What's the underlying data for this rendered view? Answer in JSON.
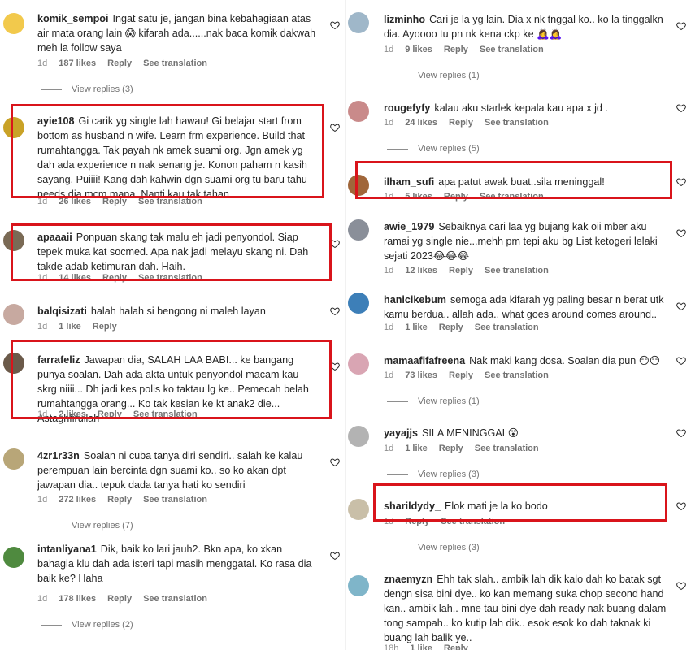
{
  "left": [
    {
      "username": "komik_sempoi",
      "text": "Ingat satu je, jangan bina kebahagiaan atas air mata orang lain 😱 kifarah ada......nak baca komik dakwah meh la follow saya",
      "time": "1d",
      "likes": "187 likes",
      "reply": "Reply",
      "translate": "See translation",
      "view_replies": "View replies (3)",
      "avatar_color": "#f2c94c"
    },
    {
      "username": "ayie108",
      "text": "Gi carik yg single lah hawau! Gi belajar start from bottom as husband n wife. Learn frm experience. Build that rumahtangga. Tak payah nk amek suami org. Jgn amek yg dah ada experience n nak senang je. Konon paham n kasih sayang. Puiiii! Kang dah kahwin dgn suami org tu baru tahu needs dia mcm mana. Nanti kau tak tahan.",
      "time": "1d",
      "likes": "26 likes",
      "reply": "Reply",
      "translate": "See translation",
      "avatar_color": "#c9a227"
    },
    {
      "username": "apaaaii",
      "text": "Ponpuan skang tak malu eh jadi penyondol. Siap tepek muka kat socmed. Apa nak jadi melayu skang ni. Dah takde adab ketimuran dah. Haih.",
      "time": "1d",
      "likes": "14 likes",
      "reply": "Reply",
      "translate": "See translation",
      "avatar_color": "#7a6a55"
    },
    {
      "username": "balqisizati",
      "text": "halah halah si bengong ni maleh layan",
      "time": "1d",
      "likes": "1 like",
      "reply": "Reply",
      "avatar_color": "#c7a9a0"
    },
    {
      "username": "farrafeliz",
      "text": "Jawapan dia, SALAH LAA BABI... ke bangang punya soalan. Dah ada akta untuk penyondol macam kau skrg niiii... Dh jadi kes polis ko taktau lg ke.. Pemecah belah rumahtangga orang... Ko tak kesian ke kt anak2 die... Astaghfirullah",
      "time": "1d",
      "likes": "2 likes",
      "reply": "Reply",
      "translate": "See translation",
      "avatar_color": "#6b5a4a"
    },
    {
      "username": "4zr1r33n",
      "text": "Soalan ni cuba tanya diri sendiri.. salah ke kalau perempuan lain bercinta dgn suami ko.. so ko akan dpt jawapan dia.. tepuk dada tanya hati ko sendiri",
      "time": "1d",
      "likes": "272 likes",
      "reply": "Reply",
      "translate": "See translation",
      "view_replies": "View replies (7)",
      "avatar_color": "#b8a678"
    },
    {
      "username": "intanliyana1",
      "text": "Dik, baik ko lari jauh2. Bkn apa, ko xkan bahagia klu dah ada isteri tapi masih menggatal. Ko rasa dia baik ke? Haha",
      "time": "1d",
      "likes": "178 likes",
      "reply": "Reply",
      "translate": "See translation",
      "view_replies": "View replies (2)",
      "avatar_color": "#4f8a3f"
    }
  ],
  "right": [
    {
      "username": "lizminho",
      "text": "Cari je la yg lain. Dia x nk tnggal ko.. ko la tinggalkn dia. Ayoooo tu pn nk kena ckp ke 🙇‍♀️🙇‍♀️",
      "time": "1d",
      "likes": "9 likes",
      "reply": "Reply",
      "translate": "See translation",
      "view_replies": "View replies (1)",
      "avatar_color": "#9fb7c9"
    },
    {
      "username": "rougefyfy",
      "text": "kalau aku starlek kepala kau apa x jd .",
      "time": "1d",
      "likes": "24 likes",
      "reply": "Reply",
      "translate": "See translation",
      "view_replies": "View replies (5)",
      "avatar_color": "#c98a8a"
    },
    {
      "username": "ilham_sufi",
      "text": "apa patut awak buat..sila meninggal!",
      "time": "1d",
      "likes": "5 likes",
      "reply": "Reply",
      "translate": "See translation",
      "avatar_color": "#a0663a"
    },
    {
      "username": "awie_1979",
      "text": "Sebaiknya cari laa yg bujang kak oii mber aku ramai yg single nie...mehh pm tepi aku bg List ketogeri lelaki sejati 2023😂😂😂",
      "time": "1d",
      "likes": "12 likes",
      "reply": "Reply",
      "translate": "See translation",
      "avatar_color": "#8a8f99"
    },
    {
      "username": "hanicikebum",
      "text": "semoga ada kifarah yg paling besar n berat utk kamu berdua.. allah ada.. what goes around comes around..",
      "time": "1d",
      "likes": "1 like",
      "reply": "Reply",
      "translate": "See translation",
      "avatar_color": "#3d7fb8"
    },
    {
      "username": "mamaafifafreena",
      "text": "Nak maki kang dosa. Soalan dia pun 😑😑",
      "time": "1d",
      "likes": "73 likes",
      "reply": "Reply",
      "translate": "See translation",
      "view_replies": "View replies (1)",
      "avatar_color": "#d9a5b3"
    },
    {
      "username": "yayajjs",
      "text": "SILA MENINGGAL😲",
      "time": "1d",
      "likes": "1 like",
      "reply": "Reply",
      "translate": "See translation",
      "view_replies": "View replies (3)",
      "avatar_color": "#b3b3b3"
    },
    {
      "username": "sharildydy_",
      "text": "Elok mati je la ko bodo",
      "time": "1d",
      "reply": "Reply",
      "translate": "See translation",
      "view_replies": "View replies (3)",
      "avatar_color": "#c9bfa8"
    },
    {
      "username": "znaemyzn",
      "text": "Ehh tak slah.. ambik lah dik kalo dah ko batak sgt dengn sisa bini dye.. ko kan memang suka chop second hand kan.. ambik lah.. mne tau bini dye dah ready nak buang dalam tong sampah.. ko kutip lah dik.. esok esok ko dah taknak ki buang lah balik ye..",
      "time": "18h",
      "likes": "1 like",
      "reply": "Reply",
      "avatar_color": "#7fb5c9"
    }
  ],
  "colors": {
    "highlight": "#d9141b",
    "text": "#262626",
    "meta": "#8e8e8e"
  }
}
